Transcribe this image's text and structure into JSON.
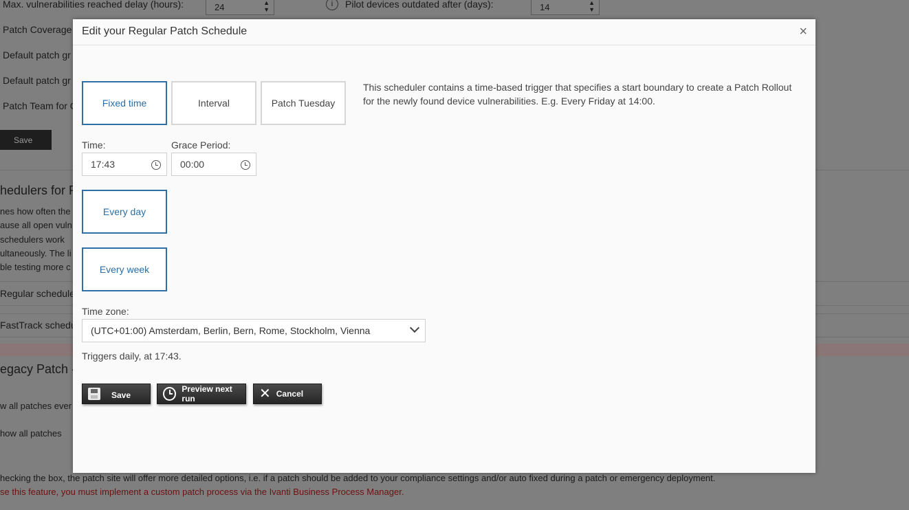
{
  "background": {
    "rows": [
      {
        "text": "Max. vulnerabilities reached delay (hours):",
        "value": "24"
      },
      {
        "text": "Pilot devices outdated after (days):",
        "value": "14"
      }
    ],
    "labels": [
      "Patch Coverage",
      "Default patch gr",
      "Default patch gr",
      "Patch Team for C"
    ],
    "save_label": "Save",
    "section1_title": "hedulers for R",
    "section1_lines": [
      "nes how often the",
      "ause all open vuln",
      "schedulers work",
      "ultaneously. The li",
      "ble testing more c"
    ],
    "regular_schedule": "Regular schedule",
    "fasttrack_schedule": "FastTrack schedu",
    "section2_title": "egacy Patch -",
    "show_all_every": "w all patches ever",
    "show_all": "how all patches",
    "note": "hecking the box, the patch site will offer more detailed options, i.e. if a patch should be added to your compliance settings and/or auto fixed during a patch or emergency deployment.",
    "note_red": "se this feature, you must implement a custom patch process via the Ivanti Business Process Manager."
  },
  "modal": {
    "title": "Edit your Regular Patch Schedule",
    "close": "×",
    "modes": [
      {
        "label": "Fixed time",
        "active": true
      },
      {
        "label": "Interval",
        "active": false
      },
      {
        "label": "Patch Tuesday",
        "active": false
      }
    ],
    "description": "This scheduler contains a time-based trigger that specifies a start boundary to create a Patch Rollout for the newly found device vulnerabilities. E.g. Every Friday at 14:00.",
    "time_label": "Time:",
    "time_value": "17:43",
    "grace_label": "Grace Period:",
    "grace_value": "00:00",
    "every_day": "Every day",
    "every_week": "Every week",
    "timezone_label": "Time zone:",
    "timezone_value": "(UTC+01:00) Amsterdam, Berlin, Bern, Rome, Stockholm, Vienna",
    "summary": "Triggers daily, at 17:43.",
    "save_label": "Save",
    "preview_label": "Preview next run",
    "cancel_label": "Cancel"
  },
  "colors": {
    "accent": "#2f6fa8",
    "button_dark": "#262626",
    "backdrop": "#7f7f7f"
  }
}
